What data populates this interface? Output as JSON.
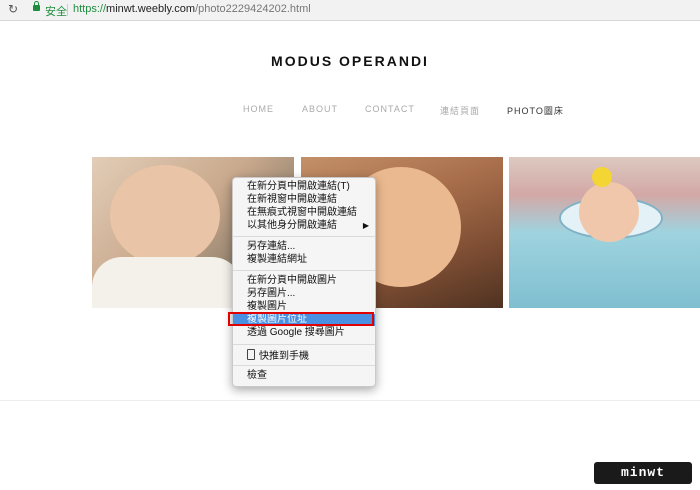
{
  "browser": {
    "reload_icon": "reload-icon",
    "secure_label": "安全",
    "url_scheme": "https://",
    "url_host": "minwt.weebly.com",
    "url_path": "/photo2229424202.html"
  },
  "site": {
    "title": "MODUS OPERANDI",
    "nav": [
      "HOME",
      "ABOUT",
      "CONTACT",
      "連結頁面",
      "PHOTO圖床"
    ]
  },
  "context_menu": {
    "group1": [
      "在新分頁中開啟連結(T)",
      "在新視窗中開啟連結",
      "在無痕式視窗中開啟連結",
      "以其他身分開啟連結"
    ],
    "group2": [
      "另存連結...",
      "複製連結網址"
    ],
    "group3": [
      "在新分頁中開啟圖片",
      "另存圖片...",
      "複製圖片",
      "複製圖片位址",
      "透過 Google 搜尋圖片"
    ],
    "group4": [
      "快推到手機"
    ],
    "group5": [
      "檢查"
    ],
    "highlighted": "複製圖片位址"
  },
  "watermark": "minwt"
}
